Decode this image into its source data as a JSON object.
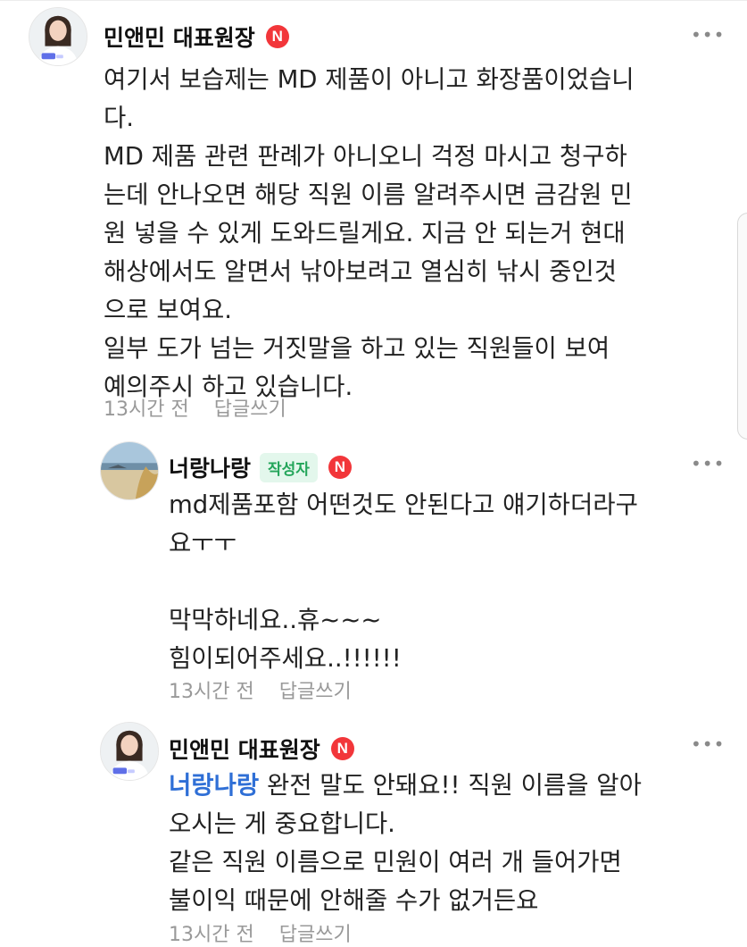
{
  "comments": [
    {
      "author": "민앤민 대표원장",
      "avatar_label": "의사",
      "body": "여기서 보습제는 MD 제품이 아니고 화장품이었습니\n다.\nMD 제품 관련 판례가 아니오니 걱정 마시고 청구하\n는데 안나오면 해당 직원 이름 알려주시면 금감원 민\n원 넣을 수 있게 도와드릴게요. 지금 안 되는거 현대\n해상에서도 알면서 낚아보려고 열심히 낚시 중인것\n으로 보여요.\n일부 도가 넘는 거짓말을 하고 있는 직원들이 보여\n예의주시 하고 있습니다.",
      "time": "13시간 전",
      "reply": "답글쓰기"
    },
    {
      "author": "너랑나랑",
      "author_tag": "작성자",
      "body": "md제품포함 어떤것도 안된다고 얘기하더라구\n요ㅜㅜ\n\n막막하네요..휴~~~\n힘이되어주세요..!!!!!!",
      "time": "13시간 전",
      "reply": "답글쓰기"
    },
    {
      "author": "민앤민 대표원장",
      "avatar_label": "의사",
      "mention": "너랑나랑",
      "body": " 완전 말도 안돼요!! 직원 이름을 알아\n오시는 게 중요합니다.\n같은 직원 이름으로 민원이 여러 개 들어가면\n불이익 때문에 안해줄 수가 없거든요",
      "time": "13시간 전",
      "reply": "답글쓰기"
    }
  ],
  "badge_letter": "N",
  "more_icon": "•••",
  "colors": {
    "badge": "#f2363a",
    "mention": "#2f6fd6",
    "author_tag_bg": "#e3f7ec",
    "author_tag_text": "#23a55a"
  }
}
